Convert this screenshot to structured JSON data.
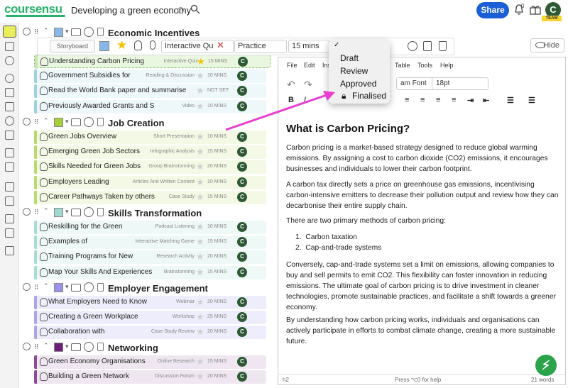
{
  "app": {
    "logo": "coursensu",
    "doc_title": "Developing a green economy",
    "share_label": "Share",
    "notifications_count": "0",
    "avatar_letter": "C",
    "team_label": "TEAM"
  },
  "colors": {
    "accent": "#1a5fd6",
    "brand": "#26b36a",
    "arrow": "#e83fd0"
  },
  "toolbar": {
    "storyboard_label": "Storyboard",
    "title_value": "Interactive Qu",
    "mode_value": "Practice",
    "duration_value": "15 mins",
    "hide_label": "Hide"
  },
  "status_menu": {
    "options": [
      "Draft",
      "Review",
      "Approved",
      "Finalised"
    ],
    "selected": "Finalised"
  },
  "sections": [
    {
      "title": "Economic Incentives",
      "color": "#8ab8e6",
      "items": [
        {
          "title": "Understanding Carbon Pricing",
          "type": "Interactive Quiz",
          "mins": "15 MINS",
          "bar": "#c6e5b3",
          "bg": "#e9f6e0"
        },
        {
          "title": "Government Subsidies for",
          "type": "Reading & Discussion",
          "mins": "10 MINS",
          "bar": "#9fd1df",
          "bg": "#eef7fa"
        },
        {
          "title": "Read the World Bank paper and summarise",
          "type": "",
          "mins": "NOT SET",
          "bar": "#9fd1df",
          "bg": "#eef7fa"
        },
        {
          "title": "Previously Awarded Grants and Similar",
          "type": "Video",
          "mins": "10 MINS",
          "bar": "#9fd1df",
          "bg": "#eef7fa"
        }
      ]
    },
    {
      "title": "Job Creation",
      "color": "#a6cf3c",
      "items": [
        {
          "title": "Green Jobs Overview",
          "type": "Short Presentation",
          "mins": "10 MINS",
          "bar": "#b7db6f",
          "bg": "#f3f9e4"
        },
        {
          "title": "Emerging Green Job Sectors",
          "type": "Infographic Analysis",
          "mins": "15 MINS",
          "bar": "#b7db6f",
          "bg": "#f3f9e4"
        },
        {
          "title": "Skills Needed for Green Jobs",
          "type": "Group Brainstorming",
          "mins": "20 MINS",
          "bar": "#b7db6f",
          "bg": "#f3f9e4"
        },
        {
          "title": "Employers Leading",
          "type": "Articles And Written Content",
          "mins": "10 MINS",
          "bar": "#b7db6f",
          "bg": "#f3f9e4"
        },
        {
          "title": "Career Pathways Taken by others",
          "type": "Case Study",
          "mins": "15 MINS",
          "bar": "#b7db6f",
          "bg": "#f3f9e4"
        }
      ]
    },
    {
      "title": "Skills Transformation",
      "color": "#9fd9cf",
      "items": [
        {
          "title": "Reskilling for the Green",
          "type": "Podcast Listening",
          "mins": "10 MINS",
          "bar": "#a8dcd2",
          "bg": "#eef8f6"
        },
        {
          "title": "Examples of",
          "type": "Interactive Matching Game",
          "mins": "15 MINS",
          "bar": "#a8dcd2",
          "bg": "#eef8f6"
        },
        {
          "title": "Training Programs for New",
          "type": "Research Activity",
          "mins": "20 MINS",
          "bar": "#a8dcd2",
          "bg": "#eef8f6"
        },
        {
          "title": "Map Your Skills And Experiences",
          "type": "Brainstorming",
          "mins": "15 MINS",
          "bar": "#a8dcd2",
          "bg": "#eef8f6"
        }
      ]
    },
    {
      "title": "Employer Engagement",
      "color": "#9a92e8",
      "items": [
        {
          "title": "What Employers Need to Know",
          "type": "Webinar",
          "mins": "20 MINS",
          "bar": "#a9a4ec",
          "bg": "#eeedfb"
        },
        {
          "title": "Creating a Green Workplace",
          "type": "Workshop",
          "mins": "25 MINS",
          "bar": "#a9a4ec",
          "bg": "#eeedfb"
        },
        {
          "title": "Collaboration with",
          "type": "Case Study Review",
          "mins": "20 MINS",
          "bar": "#a9a4ec",
          "bg": "#eeedfb"
        }
      ]
    },
    {
      "title": "Networking",
      "color": "#6d1f7a",
      "items": [
        {
          "title": "Green Economy Organisations",
          "type": "Online Research",
          "mins": "15 MINS",
          "bar": "#8a4b98",
          "bg": "#efe6f1"
        },
        {
          "title": "Building a Green Network",
          "type": "Discussion Forum",
          "mins": "20 MINS",
          "bar": "#8a4b98",
          "bg": "#efe6f1"
        }
      ]
    }
  ],
  "editor": {
    "menu": [
      "File",
      "Edit",
      "Ins",
      "Table",
      "Tools",
      "Help"
    ],
    "font_value": "am Font",
    "size_value": "18pt",
    "heading": "What is Carbon Pricing?",
    "p1": "Carbon pricing is a market-based strategy designed to reduce global warming emissions. By assigning a cost to carbon dioxide (CO2) emissions, it encourages businesses and individuals to lower their carbon footprint.",
    "p2": "A carbon tax directly sets a price on greenhouse gas emissions, incentivising carbon-intensive emitters to decrease their pollution output and review how they can decarbonise their entire supply chain.",
    "p3": "There are two primary methods of carbon pricing:",
    "list": [
      "Carbon taxation",
      "Cap-and-trade systems"
    ],
    "p4": "Conversely, cap-and-trade systems set a limit on emissions, allowing companies to buy and sell permits to emit CO2. This flexibility can foster innovation in reducing emissions. The ultimate goal of carbon pricing is to drive investment in cleaner technologies, promote sustainable practices, and facilitate a shift towards a greener economy.",
    "p5": "By understanding how carbon pricing works, individuals and organisations can actively participate in efforts to combat climate change, creating a more sustainable future.",
    "footer_tag": "h2",
    "footer_help": "Press ⌥0 for help",
    "footer_words": "21 words"
  }
}
